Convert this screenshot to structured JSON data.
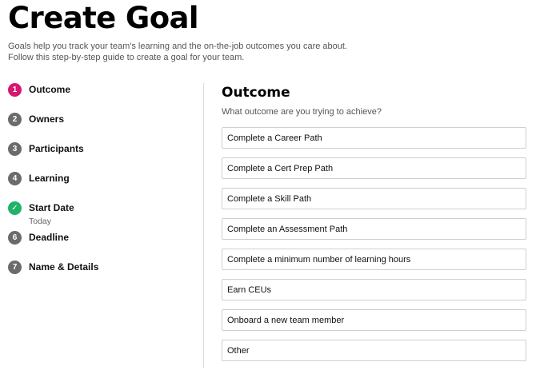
{
  "page": {
    "title": "Create Goal",
    "intro_line1": "Goals help you track your team's learning and the on-the-job outcomes you care about.",
    "intro_line2": "Follow this step-by-step guide to create a goal for your team."
  },
  "steps": [
    {
      "number": "1",
      "label": "Outcome",
      "state": "active"
    },
    {
      "number": "2",
      "label": "Owners",
      "state": "pending"
    },
    {
      "number": "3",
      "label": "Participants",
      "state": "pending"
    },
    {
      "number": "4",
      "label": "Learning",
      "state": "pending"
    },
    {
      "number": "✓",
      "label": "Start Date",
      "sublabel": "Today",
      "state": "completed"
    },
    {
      "number": "6",
      "label": "Deadline",
      "state": "pending"
    },
    {
      "number": "7",
      "label": "Name & Details",
      "state": "pending"
    }
  ],
  "panel": {
    "title": "Outcome",
    "question": "What outcome are you trying to achieve?",
    "options": [
      "Complete a Career Path",
      "Complete a Cert Prep Path",
      "Complete a Skill Path",
      "Complete an Assessment Path",
      "Complete a minimum number of learning hours",
      "Earn CEUs",
      "Onboard a new team member",
      "Other"
    ]
  },
  "colors": {
    "active_step": "#d6166f",
    "completed_step": "#21b26a",
    "pending_step": "#6b6b6b"
  }
}
